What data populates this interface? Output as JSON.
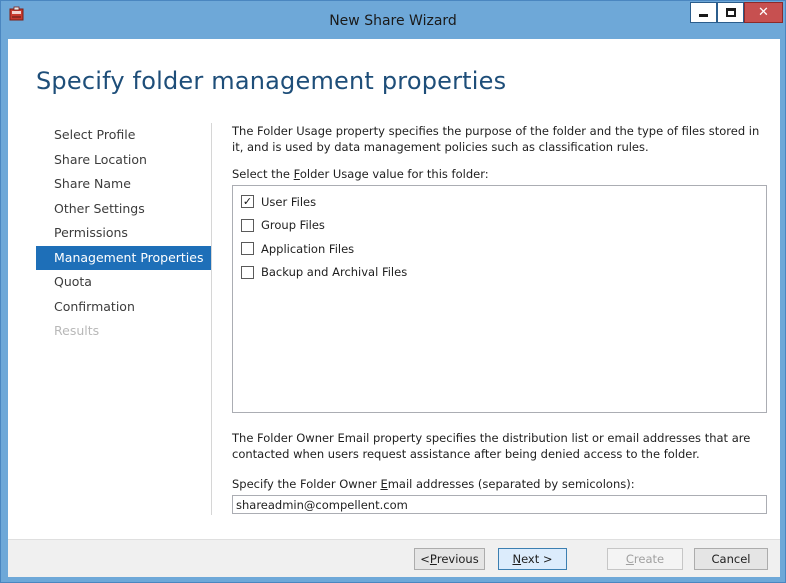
{
  "window": {
    "title": "New Share Wizard",
    "icons": {
      "app": "share-wizard-icon",
      "minimize": "minimize-icon",
      "maximize": "maximize-icon",
      "close": "close-icon"
    }
  },
  "page": {
    "title": "Specify folder management properties"
  },
  "nav": {
    "items": [
      {
        "label": "Select Profile",
        "state": "normal"
      },
      {
        "label": "Share Location",
        "state": "normal"
      },
      {
        "label": "Share Name",
        "state": "normal"
      },
      {
        "label": "Other Settings",
        "state": "normal"
      },
      {
        "label": "Permissions",
        "state": "normal"
      },
      {
        "label": "Management Properties",
        "state": "active"
      },
      {
        "label": "Quota",
        "state": "normal"
      },
      {
        "label": "Confirmation",
        "state": "normal"
      },
      {
        "label": "Results",
        "state": "disabled"
      }
    ]
  },
  "content": {
    "usage_description": "The Folder Usage property specifies the purpose of the folder and the type of files stored in it, and is used by data management policies such as classification rules.",
    "select_label": {
      "before": "Select the ",
      "accel": "F",
      "after": "older Usage value for this folder:"
    },
    "usage_options": [
      {
        "label": "User Files",
        "checked": true
      },
      {
        "label": "Group Files",
        "checked": false
      },
      {
        "label": "Application Files",
        "checked": false
      },
      {
        "label": "Backup and Archival Files",
        "checked": false
      }
    ],
    "owner_description": "The Folder Owner Email property specifies the distribution list or email addresses that are contacted when users request assistance after being denied access to the folder.",
    "email_label": {
      "before": "Specify the Folder Owner ",
      "accel": "E",
      "after": "mail addresses (separated by semicolons):"
    },
    "email_value": "shareadmin@compellent.com"
  },
  "footer": {
    "previous": {
      "before": "< ",
      "accel": "P",
      "after": "revious"
    },
    "next": {
      "before": "",
      "accel": "N",
      "after": "ext >"
    },
    "create": {
      "before": "",
      "accel": "C",
      "after": "reate"
    },
    "cancel": "Cancel"
  },
  "colors": {
    "accent": "#1e6fb8",
    "title_bar": "#6ea8d8",
    "close_button": "#c75050",
    "page_title": "#1e4e79"
  }
}
